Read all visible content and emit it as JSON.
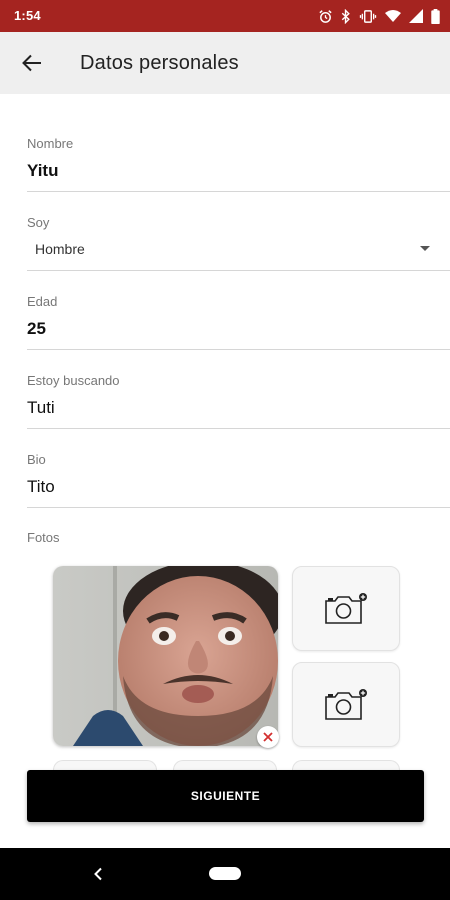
{
  "status_bar": {
    "time": "1:54",
    "icons": [
      "alarm-icon",
      "bluetooth-icon",
      "vibrate-icon",
      "wifi-icon",
      "signal-icon",
      "battery-icon"
    ],
    "color": "#a52420"
  },
  "app_bar": {
    "title": "Datos personales",
    "back_icon": "arrow-left-icon"
  },
  "form": {
    "nombre": {
      "label": "Nombre",
      "value": "Yitu"
    },
    "soy": {
      "label": "Soy",
      "selected": "Hombre"
    },
    "edad": {
      "label": "Edad",
      "value": "25"
    },
    "estoy_buscando": {
      "label": "Estoy buscando",
      "value": "Tuti"
    },
    "bio": {
      "label": "Bio",
      "value": "Tito"
    }
  },
  "photos": {
    "label": "Fotos",
    "main_photo": "selfie-photo",
    "remove_icon": "close-icon",
    "empty_slot_icon": "camera-add-icon",
    "remove_color": "#d32f2f"
  },
  "actions": {
    "next_label": "SIGUIENTE"
  },
  "nav_bar": {
    "back_icon": "nav-back-icon",
    "home_icon": "nav-home-pill"
  }
}
